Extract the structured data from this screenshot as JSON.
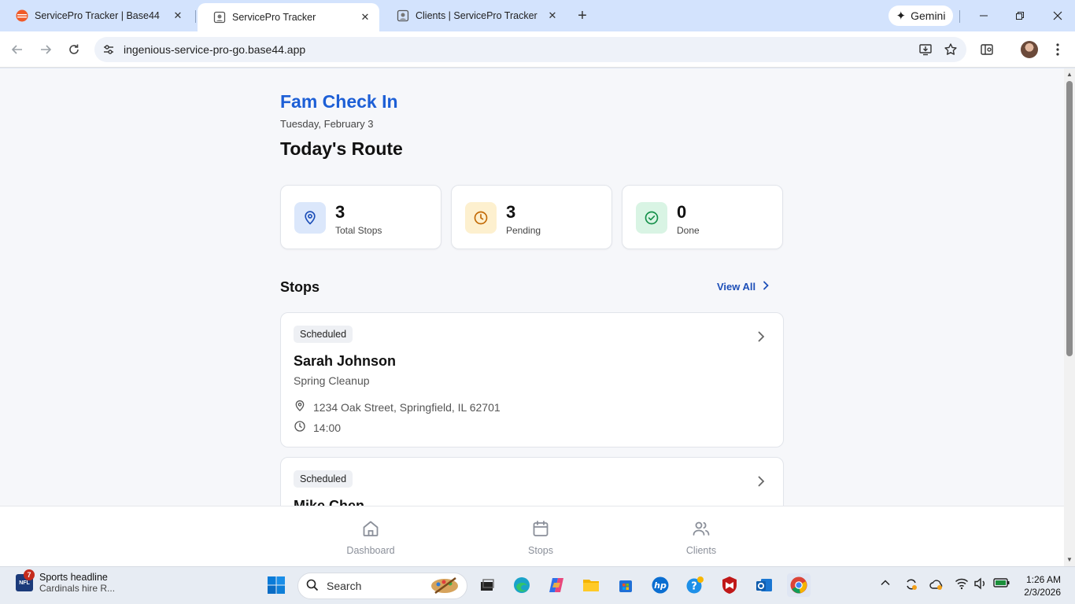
{
  "browser": {
    "tabs": [
      {
        "title": "ServicePro Tracker | Base44",
        "icon": "base44-favicon",
        "active": false
      },
      {
        "title": "ServicePro Tracker",
        "icon": "page-favicon",
        "active": true
      },
      {
        "title": "Clients | ServicePro Tracker",
        "icon": "page-favicon",
        "active": false
      }
    ],
    "gemini_label": "Gemini",
    "url": "ingenious-service-pro-go.base44.app"
  },
  "app": {
    "brand": "Fam Check In",
    "date": "Tuesday, February 3",
    "heading": "Today's Route",
    "stats": [
      {
        "value": "3",
        "label": "Total Stops",
        "icon": "map-pin-icon",
        "color": "#dbe7fb"
      },
      {
        "value": "3",
        "label": "Pending",
        "icon": "clock-icon",
        "color": "#fdf0cf"
      },
      {
        "value": "0",
        "label": "Done",
        "icon": "check-circle-icon",
        "color": "#d9f4e4"
      }
    ],
    "section_title": "Stops",
    "view_all": "View All",
    "stops": [
      {
        "status": "Scheduled",
        "name": "Sarah Johnson",
        "service": "Spring Cleanup",
        "address": "1234 Oak Street, Springfield, IL 62701",
        "time": "14:00"
      },
      {
        "status": "Scheduled",
        "name": "Mike Chen"
      }
    ],
    "nav": [
      {
        "label": "Dashboard",
        "icon": "home-icon"
      },
      {
        "label": "Stops",
        "icon": "calendar-icon"
      },
      {
        "label": "Clients",
        "icon": "users-icon"
      }
    ]
  },
  "taskbar": {
    "news_badge": "7",
    "news_title": "Sports headline",
    "news_sub": "Cardinals hire R...",
    "search_placeholder": "Search",
    "time": "1:26 AM",
    "date": "2/3/2026"
  }
}
